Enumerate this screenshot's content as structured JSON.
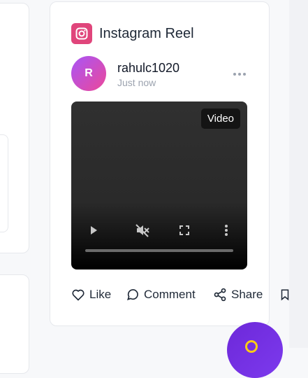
{
  "post": {
    "platform_label": "Instagram Reel",
    "avatar_initial": "R",
    "username": "rahulc1020",
    "timestamp": "Just now",
    "video_badge": "Video"
  },
  "actions": {
    "like": "Like",
    "comment": "Comment",
    "share": "Share"
  },
  "colors": {
    "instagram_accent": "#e0457b",
    "avatar_gradient_start": "#a855f7",
    "avatar_gradient_end": "#ec4899",
    "fab": "#7c3aed"
  },
  "icons": [
    "instagram-icon",
    "more-options-icon",
    "play-icon",
    "mute-icon",
    "fullscreen-icon",
    "video-options-icon",
    "heart-icon",
    "comment-icon",
    "share-icon",
    "bookmark-icon"
  ]
}
